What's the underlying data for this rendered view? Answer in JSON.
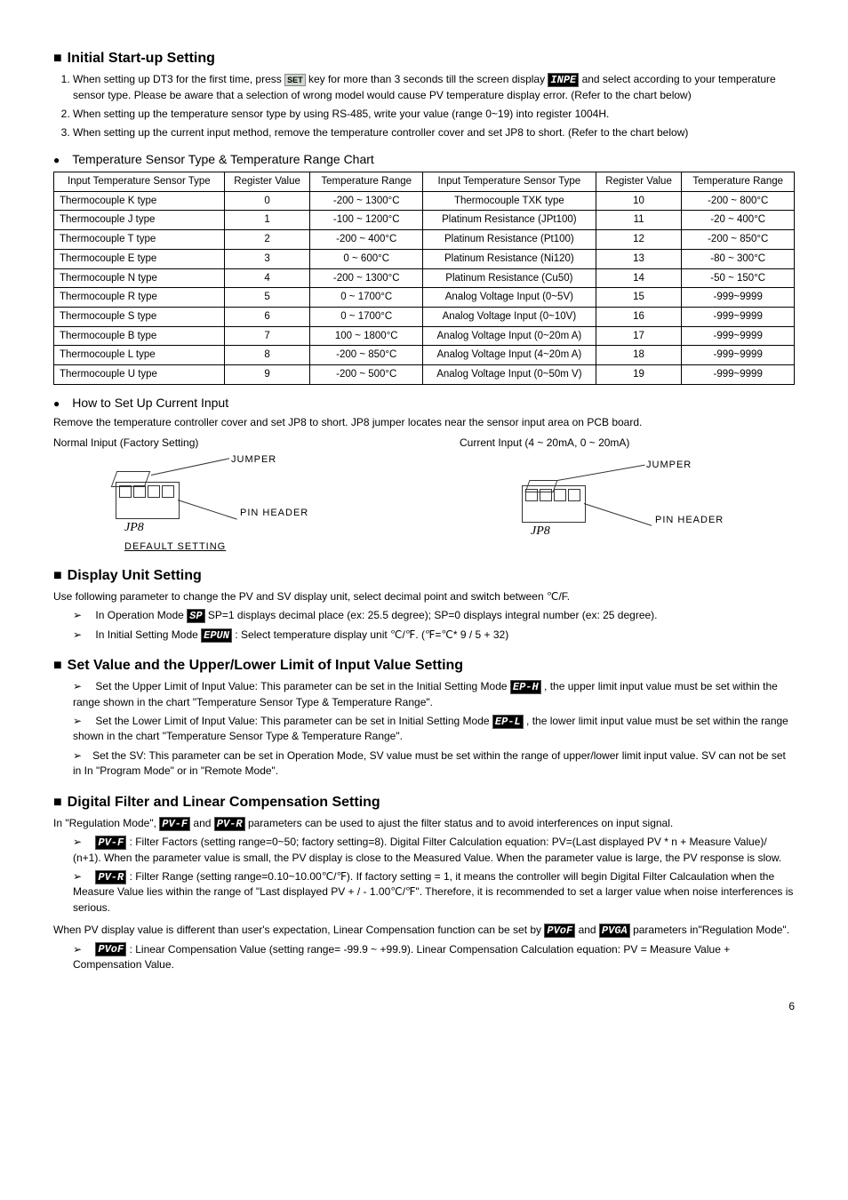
{
  "sections": {
    "initial": {
      "title": "Initial Start-up Setting",
      "items": [
        {
          "pre": "When setting up DT3 for the first time, press ",
          "key": "SET",
          "mid": " key for more than 3 seconds till the screen display ",
          "lcd": "INPE",
          "post": " and select according to your temperature sensor type. Please be aware that a selection of wrong model would cause PV temperature display error. (Refer to the chart below)"
        },
        {
          "text": "When setting up the temperature sensor type by using RS-485, write your value (range 0~19) into register 1004H."
        },
        {
          "text": "When setting up the current input method, remove the temperature controller cover and set JP8 to short.   (Refer to the chart below)"
        }
      ],
      "chart_title": "Temperature Sensor Type & Temperature Range Chart"
    },
    "howto": {
      "title": "How to Set Up Current Input",
      "desc": "Remove the temperature controller cover and set JP8 to short. JP8 jumper locates near the sensor input area on PCB board.",
      "left_label": "Normal Iniput (Factory Setting)",
      "right_label": "Current Input (4 ~ 20mA, 0 ~ 20mA)",
      "jumper": "JUMPER",
      "jp8": "JP8",
      "pin": "PIN HEADER",
      "default": "DEFAULT SETTING"
    },
    "display": {
      "title": "Display Unit Setting",
      "intro": "Use following parameter to change the PV and SV display unit,   select decimal point and switch between ℃/F.",
      "op_pre": "In Operation Mode ",
      "op_lcd": "   SP",
      "op_post": " SP=1 displays decimal place (ex: 25.5 degree); SP=0 displays integral number (ex: 25 degree).",
      "init_pre": "In Initial Setting Mode ",
      "init_lcd": "EPUN",
      "init_post": ": Select temperature display unit ℃/℉. (℉=℃* 9 / 5 + 32)"
    },
    "setvalue": {
      "title": "Set Value and the Upper/Lower Limit of Input Value Setting",
      "items": [
        {
          "pre": "Set the Upper Limit of Input Value: This parameter can be set in the Initial Setting Mode ",
          "lcd": "EP-H",
          "post": ", the upper limit input value must be set within the range shown in the chart \"Temperature Sensor Type & Temperature Range\"."
        },
        {
          "pre": "Set the Lower Limit of Input Value: This parameter can be set in Initial Setting Mode ",
          "lcd": "EP-L",
          "post": ", the lower limit input value must be set within the range shown in the chart \"Temperature Sensor Type & Temperature Range\"."
        },
        {
          "text": "Set the SV: This parameter can be set in Operation Mode, SV value must be set within the range of upper/lower limit input value. SV can not be set in In \"Program Mode\" or in \"Remote Mode\"."
        }
      ]
    },
    "filter": {
      "title": "Digital Filter and Linear Compensation Setting",
      "intro_pre": "In \"Regulation Mode\", ",
      "lcd1": "PV-F",
      "intro_mid": " and ",
      "lcd2": "PV-R",
      "intro_post": " parameters can be used to ajust the filter status and to avoid interferences on input signal.",
      "item1_lcd": "PV-F",
      "item1_text": ": Filter Factors (setting range=0~50; factory setting=8). Digital Filter Calculation equation: PV=(Last displayed PV * n + Measure Value)/ (n+1). When the parameter value is small, the PV display is close to the Measured Value. When the parameter value is large, the PV response is slow.",
      "item2_lcd": "PV-R",
      "item2_text": ": Filter Range (setting range=0.10~10.00℃/℉). If factory setting = 1, it means the controller will begin Digital Filter Calcaulation when the Measure Value lies within the range of \"Last displayed PV + / - 1.00℃/℉\". Therefore, it is recommended to set a larger value when noise interferences is serious.",
      "lin_pre": "When PV display value is different than user's expectation, Linear Compensation function can be set by ",
      "lin_lcd1": "PVoF",
      "lin_mid": " and ",
      "lin_lcd2": "PVGA",
      "lin_post": " parameters in\"Regulation Mode\".",
      "item3_lcd": "PVoF",
      "item3_text": ": Linear Compensation Value (setting range= -99.9 ~ +99.9). Linear Compensation Calculation equation: PV = Measure Value + Compensation Value."
    }
  },
  "table": {
    "headers": [
      "Input Temperature Sensor Type",
      "Register Value",
      "Temperature Range",
      "Input Temperature Sensor Type",
      "Register Value",
      "Temperature Range"
    ],
    "rows": [
      [
        "Thermocouple K type",
        "0",
        "-200 ~ 1300°C",
        "Thermocouple TXK type",
        "10",
        "-200 ~ 800°C"
      ],
      [
        "Thermocouple J type",
        "1",
        "-100 ~ 1200°C",
        "Platinum Resistance (JPt100)",
        "11",
        "-20 ~ 400°C"
      ],
      [
        "Thermocouple T type",
        "2",
        "-200 ~ 400°C",
        "Platinum Resistance (Pt100)",
        "12",
        "-200 ~ 850°C"
      ],
      [
        "Thermocouple E type",
        "3",
        "0 ~ 600°C",
        "Platinum Resistance (Ni120)",
        "13",
        "-80 ~ 300°C"
      ],
      [
        "Thermocouple N type",
        "4",
        "-200 ~ 1300°C",
        "Platinum Resistance (Cu50)",
        "14",
        "-50 ~ 150°C"
      ],
      [
        "Thermocouple R type",
        "5",
        "0 ~ 1700°C",
        "Analog Voltage Input (0~5V)",
        "15",
        "-999~9999"
      ],
      [
        "Thermocouple S type",
        "6",
        "0 ~ 1700°C",
        "Analog Voltage Input (0~10V)",
        "16",
        "-999~9999"
      ],
      [
        "Thermocouple B type",
        "7",
        "100 ~ 1800°C",
        "Analog Voltage Input (0~20m A)",
        "17",
        "-999~9999"
      ],
      [
        "Thermocouple L type",
        "8",
        "-200 ~ 850°C",
        "Analog Voltage Input (4~20m A)",
        "18",
        "-999~9999"
      ],
      [
        "Thermocouple U type",
        "9",
        "-200 ~ 500°C",
        "Analog Voltage Input (0~50m V)",
        "19",
        "-999~9999"
      ]
    ]
  },
  "page": "6",
  "chart_data": {
    "type": "table",
    "title": "Temperature Sensor Type & Temperature Range Chart",
    "columns": [
      "Input Temperature Sensor Type",
      "Register Value",
      "Temperature Range"
    ],
    "rows": [
      {
        "sensor": "Thermocouple K type",
        "register": 0,
        "range": "-200 ~ 1300°C"
      },
      {
        "sensor": "Thermocouple J type",
        "register": 1,
        "range": "-100 ~ 1200°C"
      },
      {
        "sensor": "Thermocouple T type",
        "register": 2,
        "range": "-200 ~ 400°C"
      },
      {
        "sensor": "Thermocouple E type",
        "register": 3,
        "range": "0 ~ 600°C"
      },
      {
        "sensor": "Thermocouple N type",
        "register": 4,
        "range": "-200 ~ 1300°C"
      },
      {
        "sensor": "Thermocouple R type",
        "register": 5,
        "range": "0 ~ 1700°C"
      },
      {
        "sensor": "Thermocouple S type",
        "register": 6,
        "range": "0 ~ 1700°C"
      },
      {
        "sensor": "Thermocouple B type",
        "register": 7,
        "range": "100 ~ 1800°C"
      },
      {
        "sensor": "Thermocouple L type",
        "register": 8,
        "range": "-200 ~ 850°C"
      },
      {
        "sensor": "Thermocouple U type",
        "register": 9,
        "range": "-200 ~ 500°C"
      },
      {
        "sensor": "Thermocouple TXK type",
        "register": 10,
        "range": "-200 ~ 800°C"
      },
      {
        "sensor": "Platinum Resistance (JPt100)",
        "register": 11,
        "range": "-20 ~ 400°C"
      },
      {
        "sensor": "Platinum Resistance (Pt100)",
        "register": 12,
        "range": "-200 ~ 850°C"
      },
      {
        "sensor": "Platinum Resistance (Ni120)",
        "register": 13,
        "range": "-80 ~ 300°C"
      },
      {
        "sensor": "Platinum Resistance (Cu50)",
        "register": 14,
        "range": "-50 ~ 150°C"
      },
      {
        "sensor": "Analog Voltage Input (0~5V)",
        "register": 15,
        "range": "-999~9999"
      },
      {
        "sensor": "Analog Voltage Input (0~10V)",
        "register": 16,
        "range": "-999~9999"
      },
      {
        "sensor": "Analog Voltage Input (0~20m A)",
        "register": 17,
        "range": "-999~9999"
      },
      {
        "sensor": "Analog Voltage Input (4~20m A)",
        "register": 18,
        "range": "-999~9999"
      },
      {
        "sensor": "Analog Voltage Input (0~50m V)",
        "register": 19,
        "range": "-999~9999"
      }
    ]
  }
}
